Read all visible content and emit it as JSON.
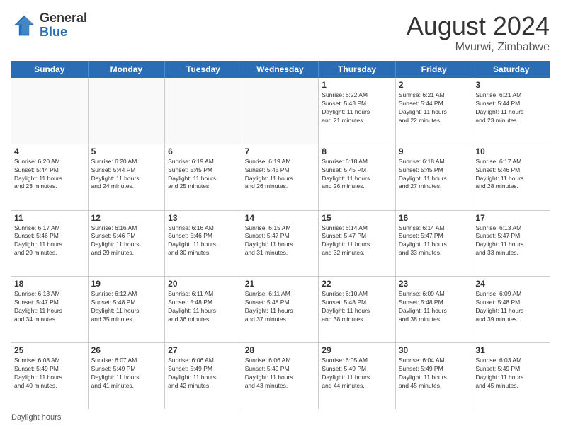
{
  "header": {
    "logo_general": "General",
    "logo_blue": "Blue",
    "title": "August 2024",
    "location": "Mvurwi, Zimbabwe"
  },
  "calendar": {
    "days_of_week": [
      "Sunday",
      "Monday",
      "Tuesday",
      "Wednesday",
      "Thursday",
      "Friday",
      "Saturday"
    ],
    "weeks": [
      [
        {
          "day": "",
          "info": ""
        },
        {
          "day": "",
          "info": ""
        },
        {
          "day": "",
          "info": ""
        },
        {
          "day": "",
          "info": ""
        },
        {
          "day": "1",
          "info": "Sunrise: 6:22 AM\nSunset: 5:43 PM\nDaylight: 11 hours\nand 21 minutes."
        },
        {
          "day": "2",
          "info": "Sunrise: 6:21 AM\nSunset: 5:44 PM\nDaylight: 11 hours\nand 22 minutes."
        },
        {
          "day": "3",
          "info": "Sunrise: 6:21 AM\nSunset: 5:44 PM\nDaylight: 11 hours\nand 23 minutes."
        }
      ],
      [
        {
          "day": "4",
          "info": "Sunrise: 6:20 AM\nSunset: 5:44 PM\nDaylight: 11 hours\nand 23 minutes."
        },
        {
          "day": "5",
          "info": "Sunrise: 6:20 AM\nSunset: 5:44 PM\nDaylight: 11 hours\nand 24 minutes."
        },
        {
          "day": "6",
          "info": "Sunrise: 6:19 AM\nSunset: 5:45 PM\nDaylight: 11 hours\nand 25 minutes."
        },
        {
          "day": "7",
          "info": "Sunrise: 6:19 AM\nSunset: 5:45 PM\nDaylight: 11 hours\nand 26 minutes."
        },
        {
          "day": "8",
          "info": "Sunrise: 6:18 AM\nSunset: 5:45 PM\nDaylight: 11 hours\nand 26 minutes."
        },
        {
          "day": "9",
          "info": "Sunrise: 6:18 AM\nSunset: 5:45 PM\nDaylight: 11 hours\nand 27 minutes."
        },
        {
          "day": "10",
          "info": "Sunrise: 6:17 AM\nSunset: 5:46 PM\nDaylight: 11 hours\nand 28 minutes."
        }
      ],
      [
        {
          "day": "11",
          "info": "Sunrise: 6:17 AM\nSunset: 5:46 PM\nDaylight: 11 hours\nand 29 minutes."
        },
        {
          "day": "12",
          "info": "Sunrise: 6:16 AM\nSunset: 5:46 PM\nDaylight: 11 hours\nand 29 minutes."
        },
        {
          "day": "13",
          "info": "Sunrise: 6:16 AM\nSunset: 5:46 PM\nDaylight: 11 hours\nand 30 minutes."
        },
        {
          "day": "14",
          "info": "Sunrise: 6:15 AM\nSunset: 5:47 PM\nDaylight: 11 hours\nand 31 minutes."
        },
        {
          "day": "15",
          "info": "Sunrise: 6:14 AM\nSunset: 5:47 PM\nDaylight: 11 hours\nand 32 minutes."
        },
        {
          "day": "16",
          "info": "Sunrise: 6:14 AM\nSunset: 5:47 PM\nDaylight: 11 hours\nand 33 minutes."
        },
        {
          "day": "17",
          "info": "Sunrise: 6:13 AM\nSunset: 5:47 PM\nDaylight: 11 hours\nand 33 minutes."
        }
      ],
      [
        {
          "day": "18",
          "info": "Sunrise: 6:13 AM\nSunset: 5:47 PM\nDaylight: 11 hours\nand 34 minutes."
        },
        {
          "day": "19",
          "info": "Sunrise: 6:12 AM\nSunset: 5:48 PM\nDaylight: 11 hours\nand 35 minutes."
        },
        {
          "day": "20",
          "info": "Sunrise: 6:11 AM\nSunset: 5:48 PM\nDaylight: 11 hours\nand 36 minutes."
        },
        {
          "day": "21",
          "info": "Sunrise: 6:11 AM\nSunset: 5:48 PM\nDaylight: 11 hours\nand 37 minutes."
        },
        {
          "day": "22",
          "info": "Sunrise: 6:10 AM\nSunset: 5:48 PM\nDaylight: 11 hours\nand 38 minutes."
        },
        {
          "day": "23",
          "info": "Sunrise: 6:09 AM\nSunset: 5:48 PM\nDaylight: 11 hours\nand 38 minutes."
        },
        {
          "day": "24",
          "info": "Sunrise: 6:09 AM\nSunset: 5:48 PM\nDaylight: 11 hours\nand 39 minutes."
        }
      ],
      [
        {
          "day": "25",
          "info": "Sunrise: 6:08 AM\nSunset: 5:49 PM\nDaylight: 11 hours\nand 40 minutes."
        },
        {
          "day": "26",
          "info": "Sunrise: 6:07 AM\nSunset: 5:49 PM\nDaylight: 11 hours\nand 41 minutes."
        },
        {
          "day": "27",
          "info": "Sunrise: 6:06 AM\nSunset: 5:49 PM\nDaylight: 11 hours\nand 42 minutes."
        },
        {
          "day": "28",
          "info": "Sunrise: 6:06 AM\nSunset: 5:49 PM\nDaylight: 11 hours\nand 43 minutes."
        },
        {
          "day": "29",
          "info": "Sunrise: 6:05 AM\nSunset: 5:49 PM\nDaylight: 11 hours\nand 44 minutes."
        },
        {
          "day": "30",
          "info": "Sunrise: 6:04 AM\nSunset: 5:49 PM\nDaylight: 11 hours\nand 45 minutes."
        },
        {
          "day": "31",
          "info": "Sunrise: 6:03 AM\nSunset: 5:49 PM\nDaylight: 11 hours\nand 45 minutes."
        }
      ]
    ]
  },
  "footer": {
    "note": "Daylight hours"
  }
}
